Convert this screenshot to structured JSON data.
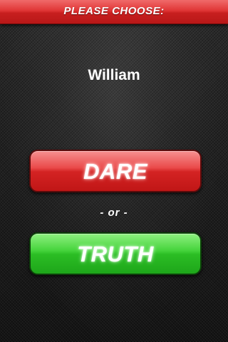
{
  "header": {
    "title": "PLEASE CHOOSE:"
  },
  "player": {
    "name": "William"
  },
  "choices": {
    "dare_label": "DARE",
    "separator": "- or -",
    "truth_label": "TRUTH"
  },
  "colors": {
    "banner": "#e03535",
    "dare": "#d42323",
    "truth": "#2bbd24",
    "background": "#1b1b1b"
  }
}
